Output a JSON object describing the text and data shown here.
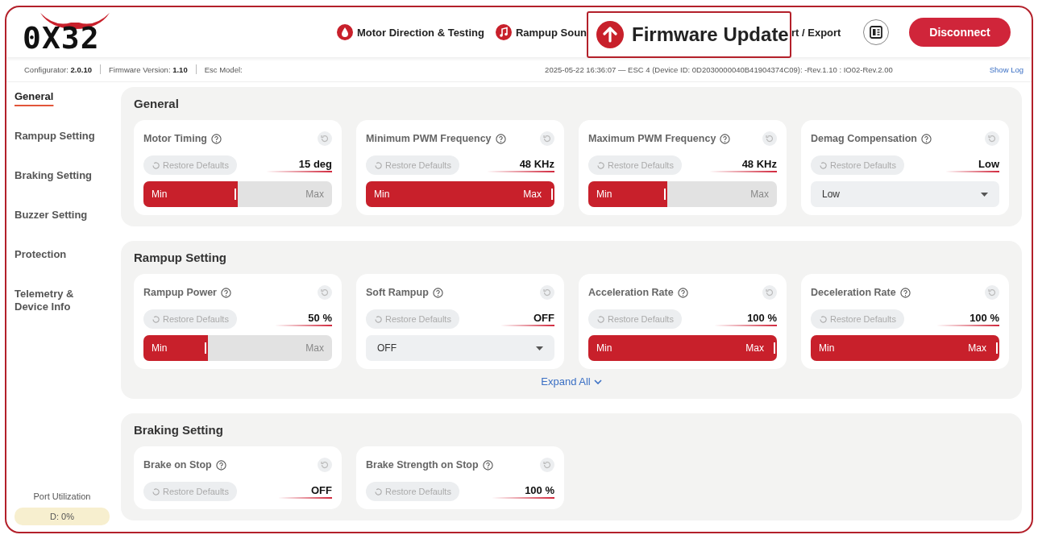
{
  "header": {
    "logo": "0X32",
    "nav": [
      {
        "label": "Motor Direction & Testing",
        "kind": "drop"
      },
      {
        "label": "Rampup Soun",
        "kind": "music"
      },
      {
        "label": "rt / Export",
        "kind": "none"
      }
    ],
    "disconnect": "Disconnect",
    "callout": {
      "label": "Firmware Update"
    }
  },
  "info_bar": {
    "configurator": "Configurator: **2.0.10**",
    "firmware": "Firmware Version: **1.10**",
    "esc_model": "Esc Model:",
    "device": "2025-05-22 16:36:07 — ESC 4 (Device ID: 0D2030000040B41904374C09): -Rev.1.10 : IO02-Rev.2.00",
    "show_log": "Show Log"
  },
  "sidebar": {
    "items": [
      {
        "label": "General",
        "selected": true
      },
      {
        "label": "Rampup Setting",
        "selected": false
      },
      {
        "label": "Braking Setting",
        "selected": false
      },
      {
        "label": "Buzzer Setting",
        "selected": false
      },
      {
        "label": "Protection",
        "selected": false
      },
      {
        "label": "Telemetry & Device Info",
        "selected": false
      }
    ],
    "port_label": "Port Utilization",
    "port_value": "D: 0%"
  },
  "sections": [
    {
      "title": "General",
      "cards": [
        {
          "title": "Motor Timing",
          "restore": "Restore Defaults",
          "value": "15 deg",
          "kind": "slider",
          "min": "Min",
          "max": "Max",
          "level": 0.5
        },
        {
          "title": "Minimum PWM Frequency",
          "restore": "Restore Defaults",
          "value": "48 KHz",
          "kind": "slider",
          "min": "Min",
          "max": "Max",
          "level": 1
        },
        {
          "title": "Maximum PWM Frequency",
          "restore": "Restore Defaults",
          "value": "48 KHz",
          "kind": "slider",
          "min": "Min",
          "max": "Max",
          "level": 0.42
        },
        {
          "title": "Demag Compensation",
          "restore": "Restore Defaults",
          "value": "Low",
          "kind": "select",
          "option": "Low"
        }
      ]
    },
    {
      "title": "Rampup Setting",
      "expand": "Expand All",
      "cards": [
        {
          "title": "Rampup Power",
          "restore": "Restore Defaults",
          "value": "50 %",
          "kind": "slider",
          "min": "Min",
          "max": "Max",
          "level": 0.34
        },
        {
          "title": "Soft Rampup",
          "restore": "Restore Defaults",
          "value": "OFF",
          "kind": "select",
          "option": "OFF"
        },
        {
          "title": "Acceleration Rate",
          "restore": "Restore Defaults",
          "value": "100 %",
          "kind": "slider",
          "min": "Min",
          "max": "Max",
          "level": 1
        },
        {
          "title": "Deceleration Rate",
          "restore": "Restore Defaults",
          "value": "100 %",
          "kind": "slider",
          "min": "Min",
          "max": "Max",
          "level": 1
        }
      ]
    },
    {
      "title": "Braking Setting",
      "cards": [
        {
          "title": "Brake on Stop",
          "restore": "Restore Defaults",
          "value": "OFF",
          "kind": "hidden"
        },
        {
          "title": "Brake Strength on Stop",
          "restore": "Restore Defaults",
          "value": "100 %",
          "kind": "hidden"
        }
      ]
    }
  ]
}
